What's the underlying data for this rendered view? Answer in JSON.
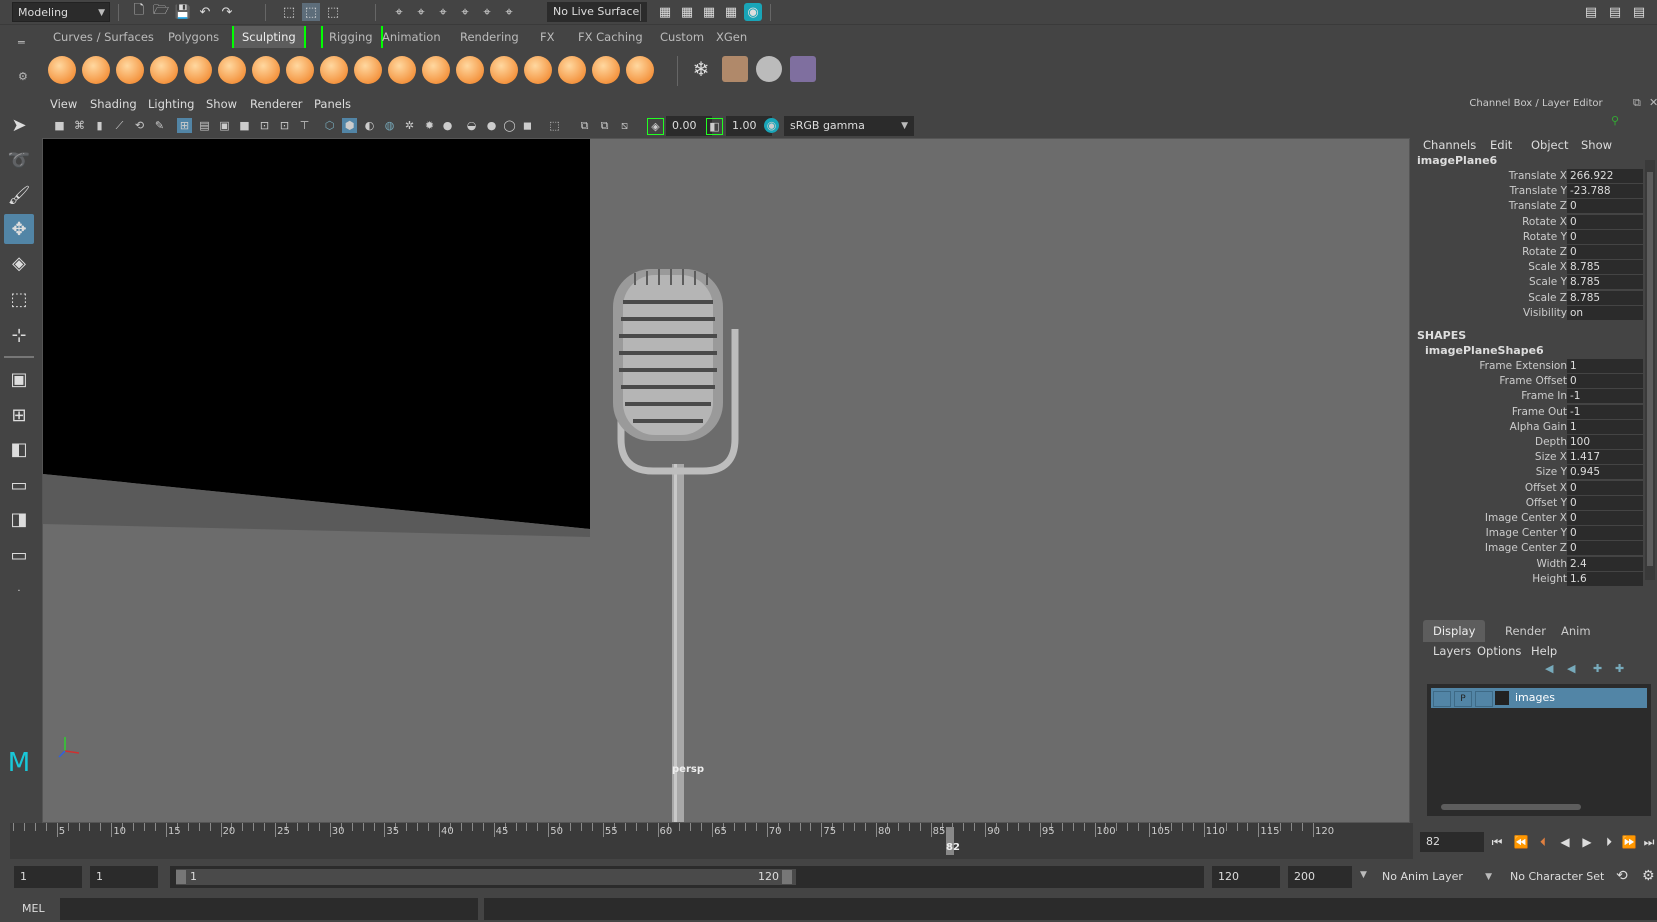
{
  "status_line": {
    "menu_set": "Modeling",
    "live_surface": "No Live Surface"
  },
  "shelf": {
    "tabs": [
      "Curves / Surfaces",
      "Polygons",
      "Sculpting",
      "Rigging",
      "Animation",
      "Rendering",
      "FX",
      "FX Caching",
      "Custom",
      "XGen"
    ],
    "active_tab": "Sculpting"
  },
  "viewport": {
    "menu": [
      "View",
      "Shading",
      "Lighting",
      "Show",
      "Renderer",
      "Panels"
    ],
    "exposure": "0.00",
    "gamma": "1.00",
    "color_space": "sRGB gamma",
    "camera_label": "persp"
  },
  "channel_box": {
    "title": "Channel Box / Layer Editor",
    "menu": [
      "Channels",
      "Edit",
      "Object",
      "Show"
    ],
    "node_name": "imagePlane6",
    "attributes": [
      {
        "label": "Translate X",
        "value": "266.922"
      },
      {
        "label": "Translate Y",
        "value": "-23.788"
      },
      {
        "label": "Translate Z",
        "value": "0"
      },
      {
        "label": "Rotate X",
        "value": "0"
      },
      {
        "label": "Rotate Y",
        "value": "0"
      },
      {
        "label": "Rotate Z",
        "value": "0"
      },
      {
        "label": "Scale X",
        "value": "8.785"
      },
      {
        "label": "Scale Y",
        "value": "8.785"
      },
      {
        "label": "Scale Z",
        "value": "8.785"
      },
      {
        "label": "Visibility",
        "value": "on"
      }
    ],
    "shapes_header": "SHAPES",
    "shape_name": "imagePlaneShape6",
    "shape_attributes": [
      {
        "label": "Frame Extension",
        "value": "1"
      },
      {
        "label": "Frame Offset",
        "value": "0"
      },
      {
        "label": "Frame In",
        "value": "-1"
      },
      {
        "label": "Frame Out",
        "value": "-1"
      },
      {
        "label": "Alpha Gain",
        "value": "1"
      },
      {
        "label": "Depth",
        "value": "100"
      },
      {
        "label": "Size X",
        "value": "1.417"
      },
      {
        "label": "Size Y",
        "value": "0.945"
      },
      {
        "label": "Offset X",
        "value": "0"
      },
      {
        "label": "Offset Y",
        "value": "0"
      },
      {
        "label": "Image Center X",
        "value": "0"
      },
      {
        "label": "Image Center Y",
        "value": "0"
      },
      {
        "label": "Image Center Z",
        "value": "0"
      },
      {
        "label": "Width",
        "value": "2.4"
      },
      {
        "label": "Height",
        "value": "1.6"
      }
    ]
  },
  "layer_editor": {
    "tabs": [
      "Display",
      "Render",
      "Anim"
    ],
    "active_tab": "Display",
    "menu": [
      "Layers",
      "Options",
      "Help"
    ],
    "layers": [
      {
        "vis": "",
        "playback": "P",
        "name": "images"
      }
    ]
  },
  "time_slider": {
    "ticks": [
      "5",
      "10",
      "15",
      "20",
      "25",
      "30",
      "35",
      "40",
      "45",
      "50",
      "55",
      "60",
      "65",
      "70",
      "75",
      "80",
      "85",
      "90",
      "95",
      "100",
      "105",
      "110",
      "115",
      "120"
    ],
    "current_frame_marker": "82",
    "current_frame": "82"
  },
  "range_slider": {
    "start_time": "1",
    "playback_start": "1",
    "range_start_label": "1",
    "range_end_label": "120",
    "playback_end": "120",
    "end_time": "200",
    "anim_layer": "No Anim Layer",
    "character_set": "No Character Set"
  },
  "command_line": {
    "language": "MEL"
  },
  "colors": {
    "bg": "#444444",
    "viewport": "#6c6c6c",
    "field": "#2b2b2b",
    "active_tab_bracket": "#00ff00",
    "layer_selected": "#5285a6"
  }
}
